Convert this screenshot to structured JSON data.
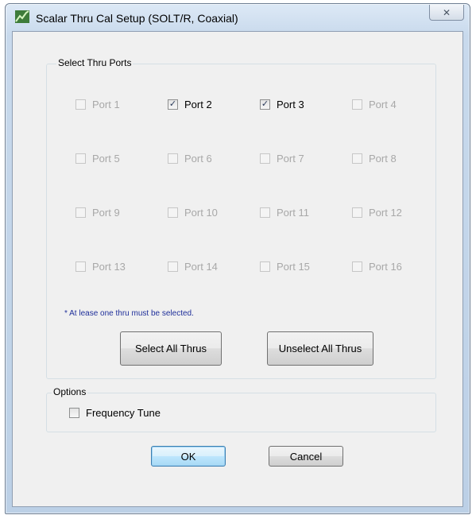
{
  "window": {
    "title": "Scalar Thru Cal Setup (SOLT/R, Coaxial)",
    "close_glyph": "✕"
  },
  "thru_ports": {
    "group_label": "Select Thru Ports",
    "ports": [
      {
        "label": "Port 1",
        "checked": false,
        "enabled": false
      },
      {
        "label": "Port 2",
        "checked": true,
        "enabled": true
      },
      {
        "label": "Port 3",
        "checked": true,
        "enabled": true
      },
      {
        "label": "Port 4",
        "checked": false,
        "enabled": false
      },
      {
        "label": "Port 5",
        "checked": false,
        "enabled": false
      },
      {
        "label": "Port 6",
        "checked": false,
        "enabled": false
      },
      {
        "label": "Port 7",
        "checked": false,
        "enabled": false
      },
      {
        "label": "Port 8",
        "checked": false,
        "enabled": false
      },
      {
        "label": "Port 9",
        "checked": false,
        "enabled": false
      },
      {
        "label": "Port 10",
        "checked": false,
        "enabled": false
      },
      {
        "label": "Port 11",
        "checked": false,
        "enabled": false
      },
      {
        "label": "Port 12",
        "checked": false,
        "enabled": false
      },
      {
        "label": "Port 13",
        "checked": false,
        "enabled": false
      },
      {
        "label": "Port 14",
        "checked": false,
        "enabled": false
      },
      {
        "label": "Port 15",
        "checked": false,
        "enabled": false
      },
      {
        "label": "Port 16",
        "checked": false,
        "enabled": false
      }
    ],
    "note": "* At lease one thru must be selected.",
    "select_all_label": "Select All Thrus",
    "unselect_all_label": "Unselect All Thrus"
  },
  "options": {
    "group_label": "Options",
    "frequency_tune_label": "Frequency Tune",
    "frequency_tune_checked": false
  },
  "buttons": {
    "ok_label": "OK",
    "cancel_label": "Cancel"
  },
  "colors": {
    "note_text": "#1f2f9a",
    "disabled_text": "#a8a8a8",
    "dialog_bg": "#f0f0f0"
  }
}
